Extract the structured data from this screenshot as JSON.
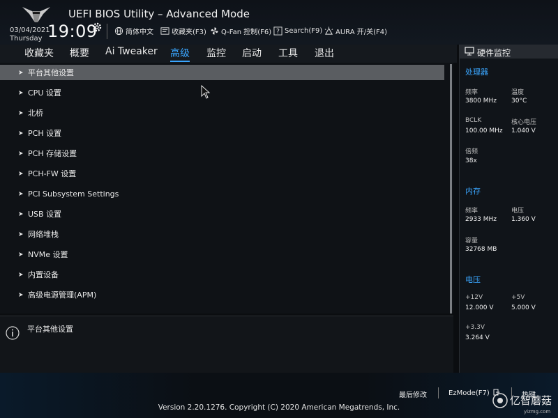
{
  "header": {
    "title": "UEFI BIOS Utility – Advanced Mode",
    "date": "03/04/2021",
    "weekday": "Thursday",
    "time": "19:09",
    "buttons": [
      {
        "label": "简体中文",
        "icon": "globe-icon"
      },
      {
        "label": "收藏夹(F3)",
        "icon": "favorites-icon"
      },
      {
        "label": "Q-Fan 控制(F6)",
        "icon": "fan-icon"
      },
      {
        "label": "Search(F9)",
        "icon": "search-help-icon"
      },
      {
        "label": "AURA 开/关(F4)",
        "icon": "aura-icon"
      }
    ]
  },
  "tabs": [
    {
      "label": "收藏夹"
    },
    {
      "label": "概要"
    },
    {
      "label": "Ai Tweaker"
    },
    {
      "label": "高级",
      "active": true
    },
    {
      "label": "监控"
    },
    {
      "label": "启动"
    },
    {
      "label": "工具"
    },
    {
      "label": "退出"
    }
  ],
  "menu": {
    "items": [
      "平台其他设置",
      "CPU 设置",
      "北桥",
      "PCH 设置",
      "PCH 存储设置",
      "PCH-FW 设置",
      "PCI Subsystem Settings",
      "USB 设置",
      "网络堆栈",
      "NVMe 设置",
      "内置设备",
      "高级电源管理(APM)"
    ],
    "selected_index": 0
  },
  "info": {
    "text": "平台其他设置"
  },
  "monitor": {
    "title": "硬件监控",
    "cpu": {
      "section": "处理器",
      "freq_label": "频率",
      "freq": "3800 MHz",
      "temp_label": "温度",
      "temp": "30°C",
      "bclk_label": "BCLK",
      "bclk": "100.00 MHz",
      "vcore_label": "核心电压",
      "vcore": "1.040 V",
      "ratio_label": "倍频",
      "ratio": "38x"
    },
    "memory": {
      "section": "内存",
      "freq_label": "频率",
      "freq": "2933 MHz",
      "volt_label": "电压",
      "volt": "1.360 V",
      "cap_label": "容量",
      "cap": "32768 MB"
    },
    "voltage": {
      "section": "电压",
      "v12_label": "+12V",
      "v12": "12.000 V",
      "v5_label": "+5V",
      "v5": "5.000 V",
      "v33_label": "+3.3V",
      "v33": "3.264 V"
    }
  },
  "footer": {
    "last_modified": "最后修改",
    "ezmode": "EzMode(F7)",
    "hotkeys": "热键",
    "version": "Version 2.20.1276. Copyright (C) 2020 American Megatrends, Inc."
  },
  "watermark": {
    "text": "亿智蘑菇",
    "sub": "yizmg.com"
  },
  "colors": {
    "accent": "#3aa6ff",
    "selected_row": "#5a5d61"
  }
}
